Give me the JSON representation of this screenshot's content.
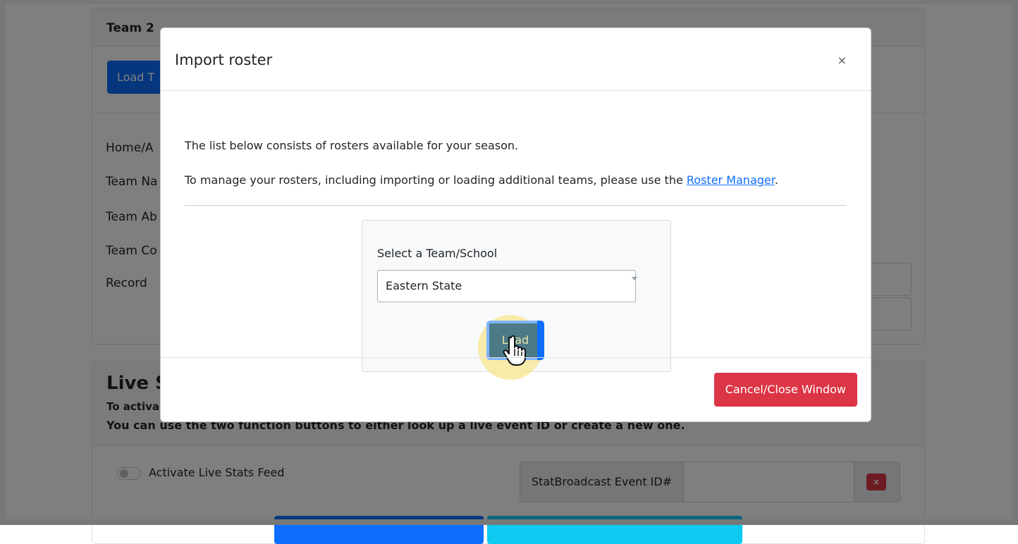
{
  "background": {
    "team2_card": {
      "title": "Team 2",
      "load_button": "Load T",
      "fields": [
        "Home/A",
        "Team Na",
        "Team Ab",
        "Team Co",
        "Record"
      ]
    },
    "live_stats_card": {
      "title": "Live S",
      "instruction_bold": "To activa",
      "instruction_text": "You can use the two function buttons to either look up a live event ID or create a new one.",
      "toggle_label": "Activate Live Stats Feed",
      "event_id_label": "StatBroadcast Event ID#",
      "clear_icon": "backspace-x-icon"
    }
  },
  "modal": {
    "title": "Import roster",
    "close_label": "×",
    "body": {
      "intro": "The list below consists of rosters available for your season.",
      "manage_prefix": "To manage your rosters, including importing or loading additional teams, please use the ",
      "manage_link": "Roster Manager",
      "manage_suffix": ".",
      "select_label": "Select a Team/School",
      "selected_team": "Eastern State",
      "load_button": "Load"
    },
    "footer": {
      "cancel_button": "Cancel/Close Window"
    }
  },
  "cursor": "pointer-hand-icon",
  "colors": {
    "primary": "#0d6efd",
    "danger": "#dc3545",
    "highlight": "#f8e48c"
  }
}
